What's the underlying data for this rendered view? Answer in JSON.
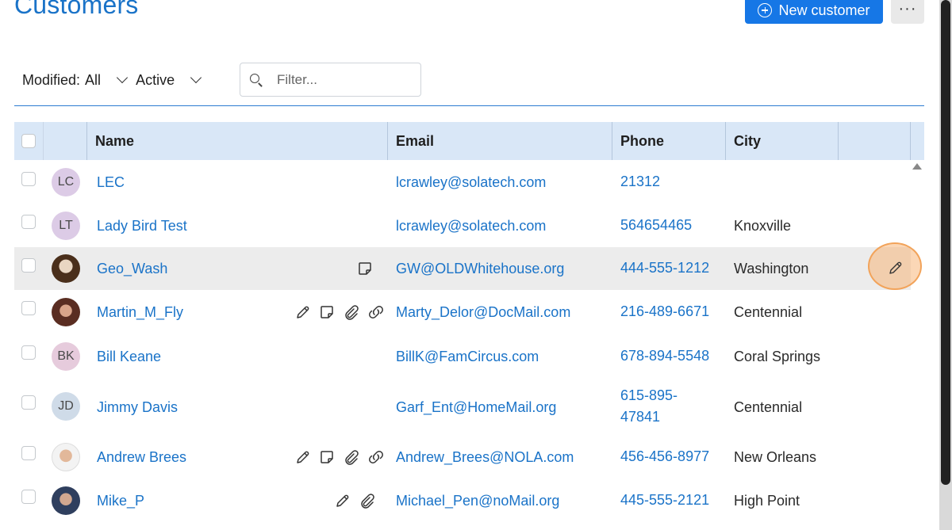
{
  "header": {
    "title": "Customers",
    "new_button_label": "New customer",
    "more_label": "···"
  },
  "filters": {
    "modified_label": "Modified:",
    "modified_value": "All",
    "status_value": "Active",
    "search_placeholder": "Filter..."
  },
  "columns": {
    "name": "Name",
    "email": "Email",
    "phone": "Phone",
    "city": "City"
  },
  "rows": [
    {
      "initials": "LC",
      "avatar_color": "#dccbe6",
      "name": "LEC",
      "email": "lcrawley@solatech.com",
      "phone": "21312",
      "city": "",
      "icons": []
    },
    {
      "initials": "LT",
      "avatar_color": "#dccbe6",
      "name": "Lady Bird Test",
      "email": "lcrawley@solatech.com",
      "phone": "564654465",
      "city": "Knoxville",
      "icons": []
    },
    {
      "initials": "",
      "avatar_color": "#5a3a22",
      "name": "Geo_Wash",
      "email": "GW@OLDWhitehouse.org",
      "phone": "444-555-1212",
      "city": "Washington",
      "icons": [
        "note-icon"
      ]
    },
    {
      "initials": "",
      "avatar_color": "#6b3b2e",
      "name": "Martin_M_Fly",
      "email": "Marty_Delor@DocMail.com",
      "phone": "216-489-6671",
      "city": "Centennial",
      "icons": [
        "pencil-icon",
        "note-icon",
        "attachment-icon",
        "link-icon"
      ]
    },
    {
      "initials": "BK",
      "avatar_color": "#e6cbdc",
      "name": "Bill Keane",
      "email": "BillK@FamCircus.com",
      "phone": "678-894-5548",
      "city": "Coral Springs",
      "icons": []
    },
    {
      "initials": "JD",
      "avatar_color": "#cfdbe8",
      "name": "Jimmy Davis",
      "email": "Garf_Ent@HomeMail.org",
      "phone": "615-895-47841",
      "phone_line1": "615-895-",
      "phone_line2": "47841",
      "city": "Centennial",
      "icons": []
    },
    {
      "initials": "",
      "avatar_color": "#c9a88a",
      "name": "Andrew Brees",
      "email": "Andrew_Brees@NOLA.com",
      "phone": "456-456-8977",
      "city": "New Orleans",
      "icons": [
        "pencil-icon",
        "note-icon",
        "attachment-icon",
        "link-icon"
      ]
    },
    {
      "initials": "",
      "avatar_color": "#3a4a66",
      "name": "Mike_P",
      "email": "Michael_Pen@noMail.org",
      "phone": "445-555-2121",
      "city": "High Point",
      "icons": [
        "pencil-icon",
        "attachment-icon"
      ]
    }
  ],
  "colors": {
    "accent": "#1677e6",
    "link": "#1a73c8",
    "header_bg": "#d9e7f7",
    "highlight_row": "#ececec",
    "edit_halo": "#f2a35a"
  }
}
